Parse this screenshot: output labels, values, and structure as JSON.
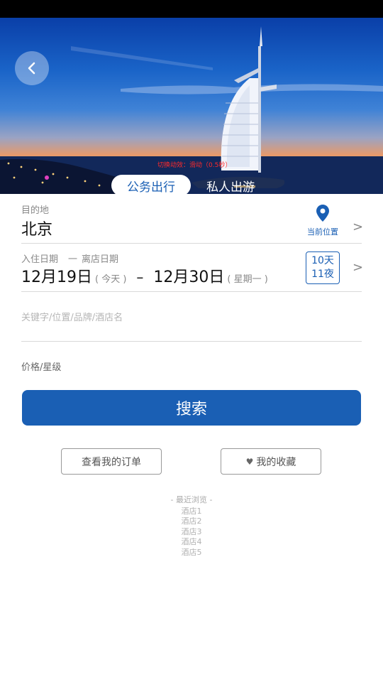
{
  "hero": {
    "animation_note": "切换动效：滑动（0.5秒）",
    "tabs": [
      "公务出行",
      "私人出游"
    ]
  },
  "destination": {
    "label": "目的地",
    "city": "北京",
    "current_location": "当前位置"
  },
  "dates": {
    "checkin_label": "入住日期",
    "dash": "一",
    "checkout_label": "离店日期",
    "checkin": "12月19日",
    "checkin_note": "( 今天 )",
    "separator": "–",
    "checkout": "12月30日",
    "checkout_note": "( 星期一 )",
    "days": "10天",
    "nights": "11夜"
  },
  "keyword": {
    "placeholder": "关键字/位置/品牌/酒店名"
  },
  "price": {
    "label": "价格/星级"
  },
  "search": {
    "label": "搜索"
  },
  "actions": {
    "orders": "查看我的订单",
    "favorites": "我的收藏"
  },
  "recent": {
    "title": "- 最近浏览 -",
    "items": [
      "酒店1",
      "酒店2",
      "酒店3",
      "酒店4",
      "酒店5"
    ]
  },
  "colors": {
    "accent": "#1a5fb4",
    "status_bar": "#000000"
  },
  "icons": {
    "back": "chevron-left-icon",
    "location": "location-pin-icon",
    "chevron": "chevron-right-icon",
    "heart": "heart-icon"
  }
}
